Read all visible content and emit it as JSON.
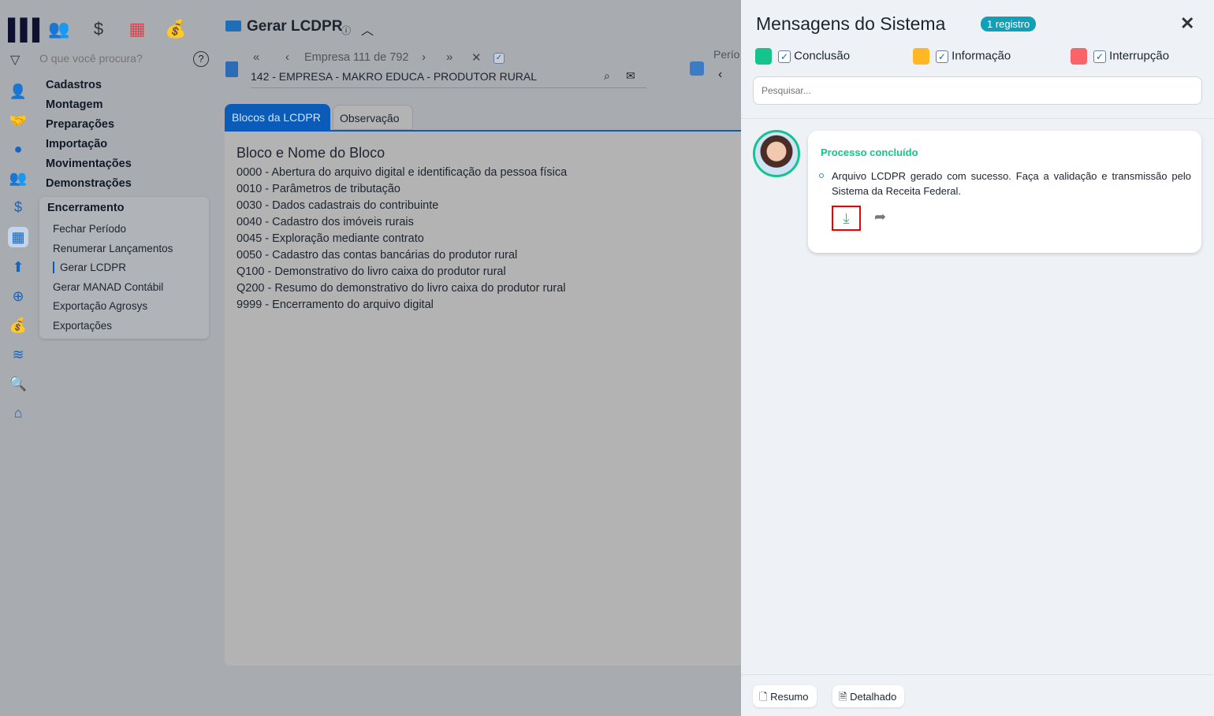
{
  "colors": {
    "conclusao": "#14c48a",
    "informacao": "#ffb822",
    "interrupcao": "#f8646a",
    "accent": "#0b5cb8"
  },
  "top_icons": [
    "people-icon",
    "dollar-icon",
    "calculator-icon",
    "money-bag-icon"
  ],
  "search": {
    "placeholder": "O que você procura?"
  },
  "menu": [
    "Cadastros",
    "Montagem",
    "Preparações",
    "Importação",
    "Movimentações",
    "Demonstrações"
  ],
  "encerramento": {
    "title": "Encerramento",
    "items": [
      "Fechar Período",
      "Renumerar Lançamentos",
      "Gerar LCDPR",
      "Gerar MANAD Contábil",
      "Exportação Agrosys",
      "Exportações"
    ]
  },
  "header": {
    "title": "Gerar LCDPR",
    "nav": "Empresa 111 de 792",
    "empresa": "142 - EMPRESA - MAKRO EDUCA - PRODUTOR RURAL",
    "periodo": "Perío"
  },
  "tabs": [
    "Blocos da LCDPR",
    "Observação"
  ],
  "blocos": {
    "title": "Bloco e Nome do Bloco",
    "items": [
      "0000 - Abertura do arquivo digital e identificação da pessoa física",
      "0010 - Parâmetros de tributação",
      "0030 - Dados cadastrais do contribuinte",
      "0040 - Cadastro dos imóveis rurais",
      "0045 - Exploração mediante contrato",
      "0050 - Cadastro das contas bancárias do produtor rural",
      "Q100 - Demonstrativo do livro caixa do produtor rural",
      "Q200 - Resumo do demonstrativo do livro caixa do produtor rural",
      "9999 - Encerramento do arquivo digital"
    ]
  },
  "panel": {
    "title": "Mensagens do Sistema",
    "badge": "1 registro",
    "filters": [
      "Conclusão",
      "Informação",
      "Interrupção"
    ],
    "search_placeholder": "Pesquisar...",
    "message": {
      "title": "Processo concluído",
      "text": "Arquivo LCDPR gerado com sucesso. Faça a validação e transmissão pelo Sistema da Receita Federal."
    },
    "footer": [
      "Resumo",
      "Detalhado"
    ]
  }
}
